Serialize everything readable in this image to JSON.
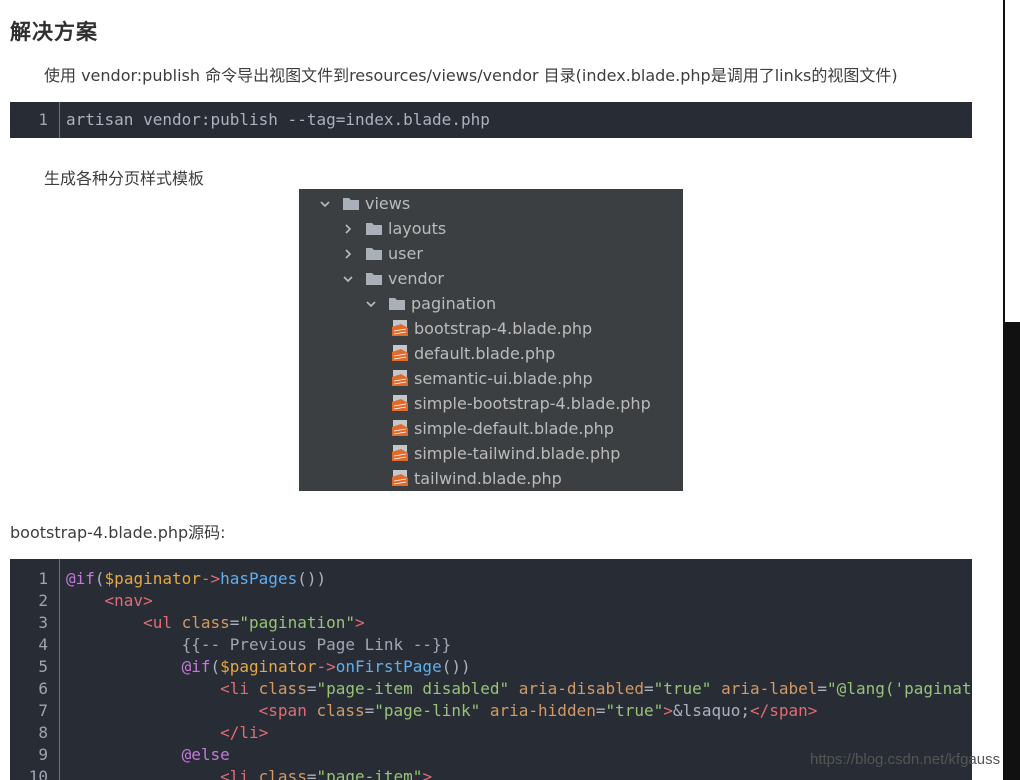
{
  "article": {
    "heading": "解决方案",
    "intro": "使用 vendor:publish 命令导出视图文件到resources/views/vendor 目录(index.blade.php是调用了links的视图文件)",
    "command_block": {
      "line_number": "1",
      "code": "artisan vendor:publish --tag=index.blade.php"
    },
    "generate_text": "生成各种分页样式模板",
    "source_caption": "bootstrap-4.blade.php源码:"
  },
  "file_tree": [
    {
      "label": "views",
      "type": "folder",
      "expanded": true,
      "depth": 0
    },
    {
      "label": "layouts",
      "type": "folder",
      "expanded": false,
      "depth": 1
    },
    {
      "label": "user",
      "type": "folder",
      "expanded": false,
      "depth": 1
    },
    {
      "label": "vendor",
      "type": "folder",
      "expanded": true,
      "depth": 1
    },
    {
      "label": "pagination",
      "type": "folder",
      "expanded": true,
      "depth": 2
    },
    {
      "label": "bootstrap-4.blade.php",
      "type": "file",
      "depth": 3
    },
    {
      "label": "default.blade.php",
      "type": "file",
      "depth": 3
    },
    {
      "label": "semantic-ui.blade.php",
      "type": "file",
      "depth": 3
    },
    {
      "label": "simple-bootstrap-4.blade.php",
      "type": "file",
      "depth": 3
    },
    {
      "label": "simple-default.blade.php",
      "type": "file",
      "depth": 3
    },
    {
      "label": "simple-tailwind.blade.php",
      "type": "file",
      "depth": 3
    },
    {
      "label": "tailwind.blade.php",
      "type": "file",
      "depth": 3
    }
  ],
  "source_code": [
    {
      "n": "1",
      "tokens": [
        [
          "kw",
          "@if"
        ],
        [
          "",
          "("
        ],
        [
          "var",
          "$paginator"
        ],
        [
          "op",
          "->"
        ],
        [
          "fn",
          "hasPages"
        ],
        [
          "",
          "())"
        ]
      ]
    },
    {
      "n": "2",
      "tokens": [
        [
          "",
          "    "
        ],
        [
          "tg",
          "<nav>"
        ]
      ]
    },
    {
      "n": "3",
      "tokens": [
        [
          "",
          "        "
        ],
        [
          "tg",
          "<ul "
        ],
        [
          "at",
          "class"
        ],
        [
          "",
          "="
        ],
        [
          "st",
          "\"pagination\""
        ],
        [
          "tg",
          ">"
        ]
      ]
    },
    {
      "n": "4",
      "tokens": [
        [
          "",
          "            "
        ],
        [
          "cm",
          "{{-- Previous Page Link --}}"
        ]
      ]
    },
    {
      "n": "5",
      "tokens": [
        [
          "",
          "            "
        ],
        [
          "kw",
          "@if"
        ],
        [
          "",
          "("
        ],
        [
          "var",
          "$paginator"
        ],
        [
          "op",
          "->"
        ],
        [
          "fn",
          "onFirstPage"
        ],
        [
          "",
          "())"
        ]
      ]
    },
    {
      "n": "6",
      "tokens": [
        [
          "",
          "                "
        ],
        [
          "tg",
          "<li "
        ],
        [
          "at",
          "class"
        ],
        [
          "",
          "="
        ],
        [
          "st",
          "\"page-item disabled\""
        ],
        [
          "",
          " "
        ],
        [
          "at",
          "aria-disabled"
        ],
        [
          "",
          "="
        ],
        [
          "st",
          "\"true\""
        ],
        [
          "",
          " "
        ],
        [
          "at",
          "aria-label"
        ],
        [
          "",
          "="
        ],
        [
          "st",
          "\"@lang('pagination.previous')\""
        ],
        [
          "tg",
          ">"
        ]
      ]
    },
    {
      "n": "7",
      "tokens": [
        [
          "",
          "                    "
        ],
        [
          "tg",
          "<span "
        ],
        [
          "at",
          "class"
        ],
        [
          "",
          "="
        ],
        [
          "st",
          "\"page-link\""
        ],
        [
          "",
          " "
        ],
        [
          "at",
          "aria-hidden"
        ],
        [
          "",
          "="
        ],
        [
          "st",
          "\"true\""
        ],
        [
          "tg",
          ">"
        ],
        [
          "",
          "&lsaquo;"
        ],
        [
          "tg",
          "</span>"
        ]
      ]
    },
    {
      "n": "8",
      "tokens": [
        [
          "",
          "                "
        ],
        [
          "tg",
          "</li>"
        ]
      ]
    },
    {
      "n": "9",
      "tokens": [
        [
          "",
          "            "
        ],
        [
          "kw",
          "@else"
        ]
      ]
    },
    {
      "n": "10",
      "tokens": [
        [
          "",
          "                "
        ],
        [
          "tg",
          "<li "
        ],
        [
          "at",
          "class"
        ],
        [
          "",
          "="
        ],
        [
          "st",
          "\"page-item\""
        ],
        [
          "tg",
          ">"
        ]
      ]
    }
  ],
  "watermark": "https://blog.csdn.net/kfgauss",
  "colors": {
    "code_bg": "#282c34",
    "tree_bg": "#3c3f41",
    "folder_icon": "#a9b0b8",
    "file_icon": "#e06a2c"
  }
}
